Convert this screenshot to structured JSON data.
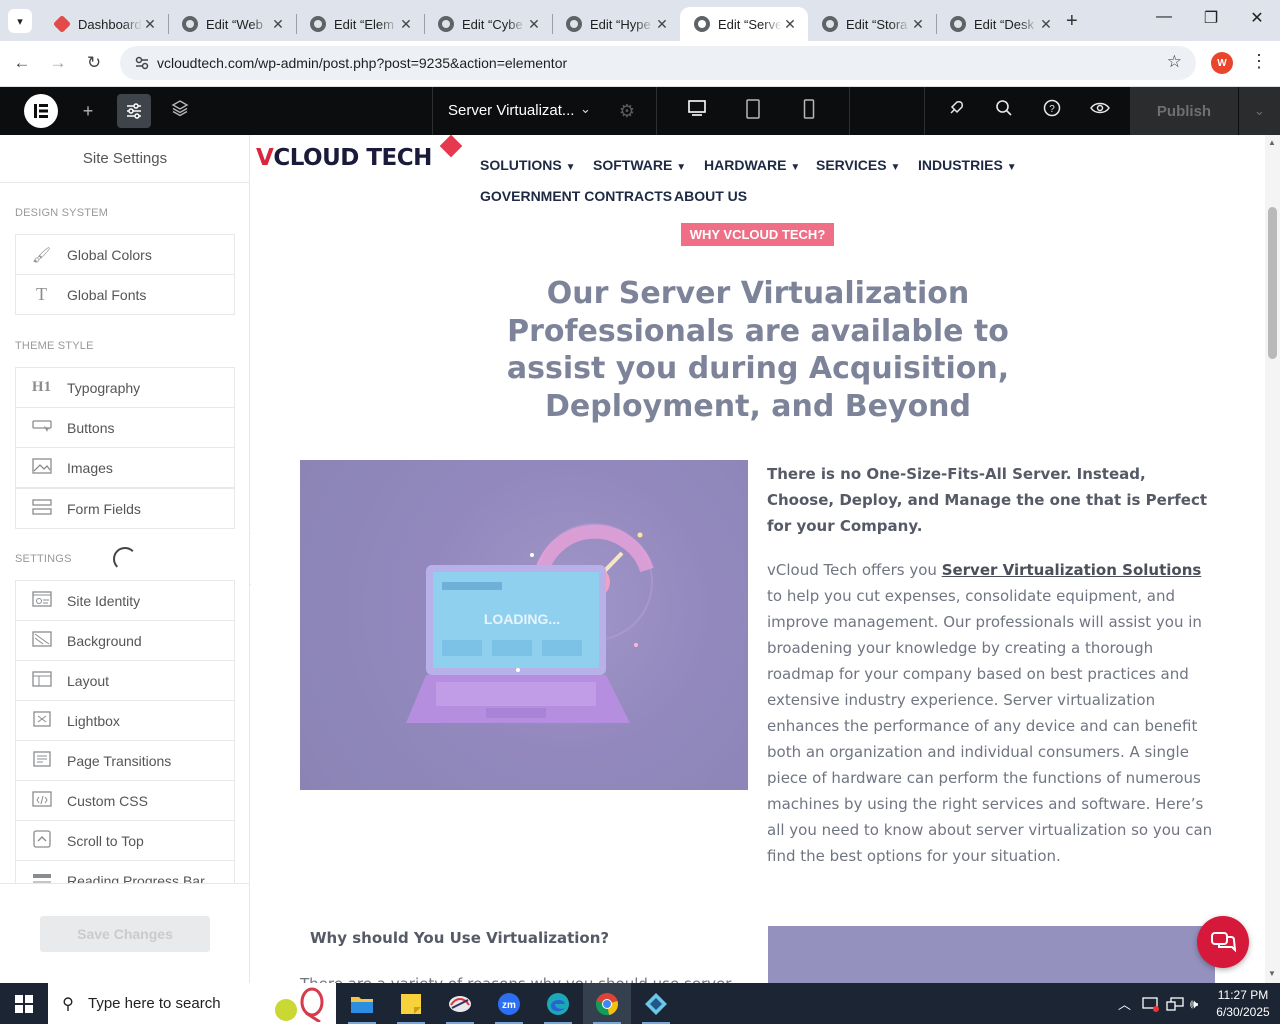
{
  "browser": {
    "tabs": [
      {
        "title": "Dashboard",
        "active": false
      },
      {
        "title": "Edit “Web",
        "active": false
      },
      {
        "title": "Edit “Elem",
        "active": false
      },
      {
        "title": "Edit “Cybe",
        "active": false
      },
      {
        "title": "Edit “Hype",
        "active": false
      },
      {
        "title": "Edit “Serve",
        "active": true
      },
      {
        "title": "Edit “Stora",
        "active": false
      },
      {
        "title": "Edit “Desk",
        "active": false
      }
    ],
    "url": "vcloudtech.com/wp-admin/post.php?post=9235&action=elementor",
    "profile_initial": "W"
  },
  "elementor": {
    "document_title": "Server Virtualizat...",
    "publish_label": "Publish"
  },
  "sidebar": {
    "title": "Site Settings",
    "design_system_label": "DESIGN SYSTEM",
    "design_system": [
      {
        "label": "Global Colors",
        "icon": "brush-icon"
      },
      {
        "label": "Global Fonts",
        "icon": "font-icon"
      }
    ],
    "theme_style_label": "THEME STYLE",
    "theme_style": [
      {
        "label": "Typography",
        "icon": "h1-icon"
      },
      {
        "label": "Buttons",
        "icon": "button-icon"
      },
      {
        "label": "Images",
        "icon": "image-icon"
      },
      {
        "label": "Form Fields",
        "icon": "form-icon"
      }
    ],
    "settings_label": "SETTINGS",
    "settings": [
      {
        "label": "Site Identity",
        "icon": "site-identity-icon"
      },
      {
        "label": "Background",
        "icon": "background-icon"
      },
      {
        "label": "Layout",
        "icon": "layout-icon"
      },
      {
        "label": "Lightbox",
        "icon": "lightbox-icon"
      },
      {
        "label": "Page Transitions",
        "icon": "page-transitions-icon"
      },
      {
        "label": "Custom CSS",
        "icon": "code-icon"
      },
      {
        "label": "Scroll to Top",
        "icon": "scroll-top-icon"
      },
      {
        "label": "Reading Progress Bar",
        "icon": "progress-bar-icon"
      }
    ],
    "save_label": "Save Changes"
  },
  "page": {
    "logo": {
      "v": "V",
      "rest": "CLOUD TECH"
    },
    "nav": {
      "solutions": "SOLUTIONS",
      "software": "SOFTWARE",
      "hardware": "HARDWARE",
      "services": "SERVICES",
      "industries": "INDUSTRIES",
      "government": "GOVERNMENT CONTRACTS",
      "about": "ABOUT US"
    },
    "badge": "WHY VCLOUD TECH?",
    "headline": "Our Server Virtualization Professionals are available to assist you during Acquisition, Deployment, and Beyond",
    "hero_image_text": "LOADING...",
    "intro_bold": "There is no One-Size-Fits-All Server. Instead, Choose, Deploy, and Manage the one that is Perfect for your Company.",
    "body_prefix": "vCloud Tech offers you ",
    "body_link": "Server Virtualization Solutions",
    "body_suffix": " to help you cut expenses, consolidate equipment, and improve management. Our professionals will assist you in broadening your knowledge by creating a thorough roadmap for your company based on best practices and extensive industry experience. Server virtualization enhances the performance of any device and can benefit both an organization and individual consumers. A single piece of hardware can perform the functions of numerous machines by using the right services and software. Here’s all you need to know about server virtualization so you can find the best options for your situation.",
    "sub_heading": "Why should You Use Virtualization?",
    "cut_text": "There are a variety of reasons why you should use server"
  },
  "taskbar": {
    "search_placeholder": "Type here to search",
    "time": "11:27 PM",
    "date": "6/30/2025"
  }
}
